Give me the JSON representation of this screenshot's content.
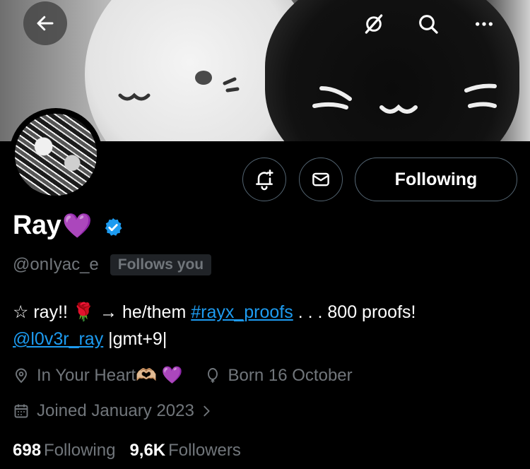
{
  "header": {
    "back_icon": "arrow-left-icon",
    "grok_icon": "grok-slash-icon",
    "search_icon": "search-icon",
    "more_icon": "more-horizontal-icon"
  },
  "profile": {
    "display_name": "Ray",
    "name_emoji": "💜",
    "verified_icon": "verified-badge-icon",
    "handle": "@onIyac_e",
    "follows_you": "Follows you",
    "buttons": {
      "notify_icon": "bell-plus-icon",
      "message_icon": "envelope-icon",
      "following_label": "Following"
    },
    "bio": {
      "part1": "☆ ray!! 🌹 → he/them ",
      "hashtag": "#rayx_proofs",
      "part2": " . . . 800 proofs!",
      "mention": "@l0v3r_ray",
      "part3": " |gmt+9|"
    },
    "location": "In Your Heart🫶🏼 💜",
    "birthday": "Born 16 October",
    "joined": "Joined January 2023",
    "following_count": "698",
    "following_label": "Following",
    "followers_count": "9,6K",
    "followers_label": "Followers"
  },
  "colors": {
    "background": "#000000",
    "primary_text": "#e7e9ea",
    "secondary_text": "#71767b",
    "link": "#1d9bf0",
    "verified": "#1d9bf0",
    "border": "#536471"
  }
}
